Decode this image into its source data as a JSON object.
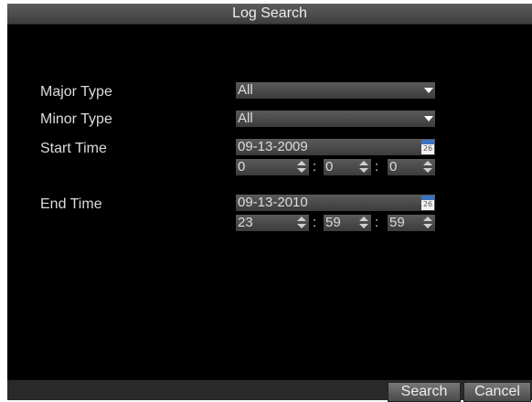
{
  "dialog": {
    "title": "Log Search"
  },
  "form": {
    "major_type": {
      "label": "Major Type",
      "value": "All"
    },
    "minor_type": {
      "label": "Minor Type",
      "value": "All"
    },
    "start_time": {
      "label": "Start Time",
      "date": "09-13-2009",
      "hour": "0",
      "minute": "0",
      "second": "0"
    },
    "end_time": {
      "label": "End Time",
      "date": "09-13-2010",
      "hour": "23",
      "minute": "59",
      "second": "59"
    },
    "calendar_icon": {
      "month": "JULY",
      "day": "26"
    },
    "time_separator": ":"
  },
  "buttons": {
    "search": "Search",
    "cancel": "Cancel"
  },
  "colors": {
    "background": "#000000",
    "field": "#4a4a4a",
    "text": "#dcdcdc"
  }
}
